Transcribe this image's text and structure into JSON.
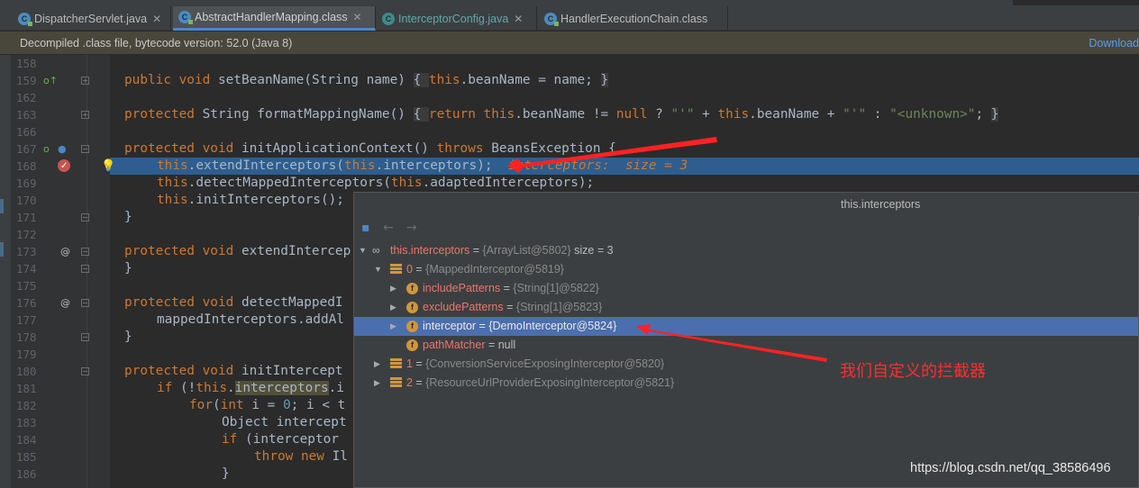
{
  "tabs": [
    {
      "label": "DispatcherServlet.java",
      "icon": "class-icon"
    },
    {
      "label": "AbstractHandlerMapping.class",
      "icon": "class-icon",
      "active": true
    },
    {
      "label": "InterceptorConfig.java",
      "icon": "java-icon"
    },
    {
      "label": "HandlerExecutionChain.class",
      "icon": "class-icon"
    }
  ],
  "banner": {
    "text": "Decompiled .class file, bytecode version: 52.0 (Java 8)",
    "download_label": "Download"
  },
  "line_numbers": [
    "158",
    "159",
    "162",
    "163",
    "166",
    "167",
    "168",
    "169",
    "170",
    "171",
    "172",
    "173",
    "174",
    "175",
    "176",
    "177",
    "178",
    "179",
    "180",
    "181",
    "182",
    "183",
    "184",
    "185",
    "186"
  ],
  "code": {
    "l159": {
      "kw": "public void",
      "text": " setBeanName(String name) ",
      "fb": "{ ",
      "kw2": "this",
      "rest": ".beanName = name; ",
      "close": "}"
    },
    "l163": {
      "kw": "protected",
      "a": " String formatMappingName() ",
      "fb": "{ ",
      "kw2": "return this",
      "b": ".beanName != ",
      "kw3": "null",
      "c": " ? ",
      "s1": "\"'\"",
      "d": " + ",
      "kw4": "this",
      "e": ".beanName + ",
      "s2": "\"'\"",
      "f": " : ",
      "s3": "\"<unknown>\"",
      "g": "; ",
      "close": "}"
    },
    "l167": {
      "kw": "protected void",
      "a": " initApplicationContext() ",
      "kw2": "throws",
      "b": " BeansException {"
    },
    "l168": {
      "kw": "this",
      "a": ".extendInterceptors(",
      "kw2": "this",
      "b": ".interceptors);",
      "inline": "interceptors:  size = 3"
    },
    "l169": {
      "kw": "this",
      "a": ".detectMappedInterceptors(",
      "kw2": "this",
      "b": ".adaptedInterceptors);"
    },
    "l170": {
      "kw": "this",
      "a": ".initInterceptors();"
    },
    "l171": "}",
    "l173": {
      "kw": "protected void",
      "a": " extendIntercep"
    },
    "l174": "}",
    "l176": {
      "kw": "protected void",
      "a": " detectMappedI"
    },
    "l177": "mappedInterceptors.addAl",
    "l178": "}",
    "l180": {
      "kw": "protected void",
      "a": " initIntercept"
    },
    "l181": {
      "kw": "if",
      "a": " (!",
      "kw2": "this",
      "b": ".",
      "u": "interceptors",
      "c": ".i"
    },
    "l182": {
      "kw": "for",
      "a": "(",
      "kw2": "int",
      "b": " i = ",
      "n": "0",
      "c": "; i < t"
    },
    "l183": "Object intercept",
    "l184": {
      "kw": "if",
      "a": " (interceptor "
    },
    "l185": {
      "kw": "throw new",
      "a": " Il"
    },
    "l186": "}"
  },
  "popup": {
    "title": "this.interceptors",
    "rows": [
      {
        "expand": "open",
        "icon": "oo",
        "name": "this.interceptors",
        "eq": " = ",
        "type": "{ArrayList@5802}",
        "value": "  size = 3"
      },
      {
        "expand": "open",
        "icon": "array-icon",
        "name": "0",
        "eq": " = ",
        "type": "{MappedInterceptor@5819}",
        "value": ""
      },
      {
        "expand": "closed",
        "icon": "field-icon",
        "name": "includePatterns",
        "eq": " = ",
        "type": "{String[1]@5822}",
        "value": ""
      },
      {
        "expand": "closed",
        "icon": "field-icon",
        "name": "excludePatterns",
        "eq": " = ",
        "type": "{String[1]@5823}",
        "value": ""
      },
      {
        "expand": "closed",
        "icon": "field-icon",
        "name": "interceptor",
        "eq": " = ",
        "type": "{DemoInterceptor@5824}",
        "value": "",
        "selected": true
      },
      {
        "expand": "none",
        "icon": "field-icon",
        "name": "pathMatcher",
        "eq": " = ",
        "type": "",
        "value": "null"
      },
      {
        "expand": "closed",
        "icon": "array-icon",
        "name": "1",
        "eq": " = ",
        "type": "{ConversionServiceExposingInterceptor@5820}",
        "value": ""
      },
      {
        "expand": "closed",
        "icon": "array-icon",
        "name": "2",
        "eq": " = ",
        "type": "{ResourceUrlProviderExposingInterceptor@5821}",
        "value": ""
      }
    ]
  },
  "annotation": {
    "text": "我们自定义的拦截器",
    "color": "#ff2d2d"
  },
  "watermark": "https://blog.csdn.net/qq_38586496",
  "colors": {
    "keyword": "#cc7832",
    "string": "#6a8759",
    "selection": "#2d5e8f",
    "popup_selection": "#4b6eaf"
  }
}
